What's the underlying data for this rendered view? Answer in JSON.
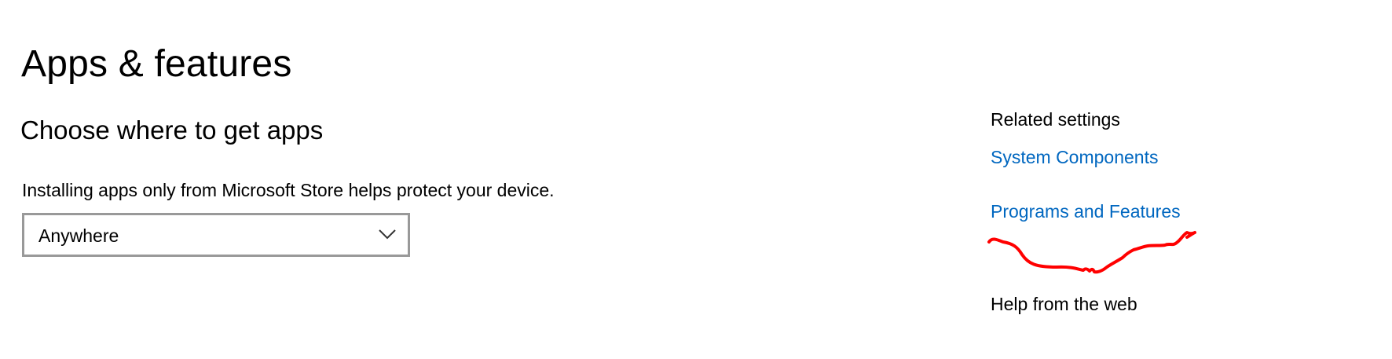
{
  "header": {
    "title": "Apps & features"
  },
  "main": {
    "section_title": "Choose where to get apps",
    "description": "Installing apps only from Microsoft Store helps protect your device.",
    "source_dropdown": {
      "selected": "Anywhere",
      "icon": "chevron-down-icon"
    }
  },
  "related_settings": {
    "heading": "Related settings",
    "links": [
      {
        "label": "System Components"
      },
      {
        "label": "Programs and Features"
      }
    ]
  },
  "help": {
    "heading": "Help from the web"
  },
  "colors": {
    "link": "#0067c0",
    "annotation": "#ff0000",
    "dropdown_border": "#999999"
  }
}
